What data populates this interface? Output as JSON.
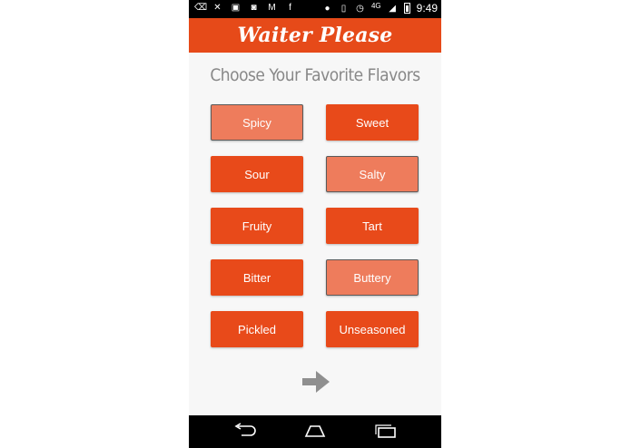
{
  "status_bar": {
    "time": "9:49",
    "network": "4G"
  },
  "app": {
    "title": "Waiter Please"
  },
  "screen": {
    "heading": "Choose Your Favorite Flavors"
  },
  "flavors": [
    {
      "label": "Spicy",
      "selected": true
    },
    {
      "label": "Sweet",
      "selected": false
    },
    {
      "label": "Sour",
      "selected": false
    },
    {
      "label": "Salty",
      "selected": true
    },
    {
      "label": "Fruity",
      "selected": false
    },
    {
      "label": "Tart",
      "selected": false
    },
    {
      "label": "Bitter",
      "selected": false
    },
    {
      "label": "Buttery",
      "selected": true
    },
    {
      "label": "Pickled",
      "selected": false
    },
    {
      "label": "Unseasoned",
      "selected": false
    }
  ],
  "next_icon": "right-arrow-icon",
  "colors": {
    "accent": "#e64a19",
    "button": "#e84a1a",
    "button_selected": "#ee7c5c",
    "heading": "#888888"
  }
}
